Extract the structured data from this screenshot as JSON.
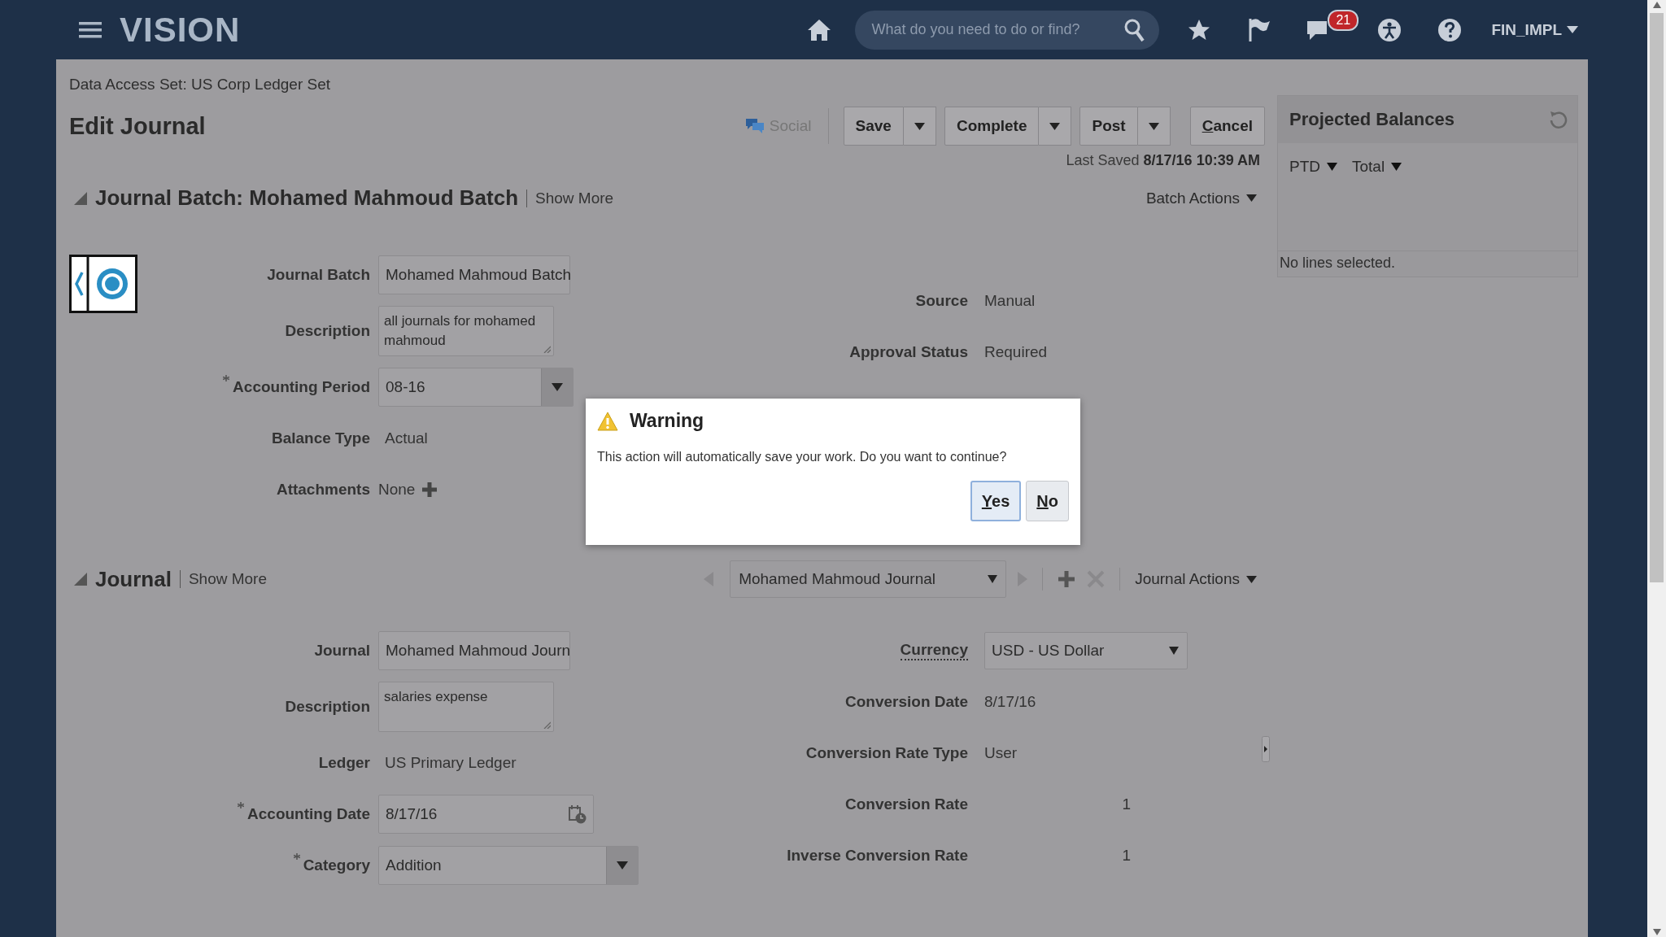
{
  "header": {
    "logo": "VISION",
    "search_placeholder": "What do you need to do or find?",
    "notification_count": "21",
    "user": "FIN_IMPL"
  },
  "data_access": "Data Access Set: US Corp Ledger Set",
  "page_title": "Edit Journal",
  "toolbar": {
    "social": "Social",
    "buttons": [
      {
        "label": "Save",
        "menu": true
      },
      {
        "label": "Complete",
        "menu": true
      },
      {
        "label": "Post",
        "menu": true
      },
      {
        "label": "Cancel",
        "menu": false
      }
    ],
    "last_saved_label": "Last Saved",
    "last_saved": "8/17/16 10:39 AM"
  },
  "batch": {
    "title": "Journal Batch: Mohamed Mahmoud Batch",
    "show_more": "Show More",
    "actions": "Batch Actions",
    "fields_left": [
      {
        "label": "Journal Batch",
        "kind": "input",
        "required": false,
        "value": "Mohamed Mahmoud Batch"
      },
      {
        "label": "Description",
        "kind": "textarea",
        "required": false,
        "value": "all journals for mohamed mahmoud"
      },
      {
        "label": "Accounting Period",
        "kind": "select",
        "required": true,
        "value": "08-16"
      },
      {
        "label": "Balance Type",
        "kind": "text",
        "required": false,
        "value": "Actual"
      },
      {
        "label": "Attachments",
        "kind": "attach",
        "required": false,
        "value": "None"
      }
    ],
    "fields_right": [
      {
        "label": "Source",
        "kind": "text",
        "value": "Manual"
      },
      {
        "label": "Approval Status",
        "kind": "text",
        "value": "Required"
      }
    ]
  },
  "projected_balances": {
    "title": "Projected Balances",
    "filters": [
      "PTD",
      "Total"
    ],
    "status": "No lines selected."
  },
  "journal": {
    "title": "Journal",
    "show_more": "Show More",
    "selector": "Mohamed Mahmoud Journal",
    "actions": "Journal Actions",
    "fields_left": [
      {
        "label": "Journal",
        "kind": "input",
        "required": false,
        "value": "Mohamed Mahmoud Journ"
      },
      {
        "label": "Description",
        "kind": "textarea",
        "required": false,
        "value": "salaries expense"
      },
      {
        "label": "Ledger",
        "kind": "text",
        "required": false,
        "value": "US Primary Ledger"
      },
      {
        "label": "Accounting Date",
        "kind": "date",
        "required": true,
        "value": "8/17/16"
      },
      {
        "label": "Category",
        "kind": "select",
        "required": true,
        "value": "Addition"
      }
    ],
    "fields_right": [
      {
        "label": "Currency",
        "kind": "select",
        "value": "USD - US Dollar"
      },
      {
        "label": "Conversion Date",
        "kind": "text",
        "value": "8/17/16"
      },
      {
        "label": "Conversion Rate Type",
        "kind": "text",
        "value": "User"
      },
      {
        "label": "Conversion Rate",
        "kind": "number",
        "value": "1"
      },
      {
        "label": "Inverse Conversion Rate",
        "kind": "number",
        "value": "1"
      }
    ]
  },
  "dialog": {
    "title": "Warning",
    "message": "This action will automatically save your work. Do you want to continue?",
    "buttons": [
      {
        "label": "Yes",
        "selected": true
      },
      {
        "label": "No",
        "selected": false
      }
    ]
  }
}
